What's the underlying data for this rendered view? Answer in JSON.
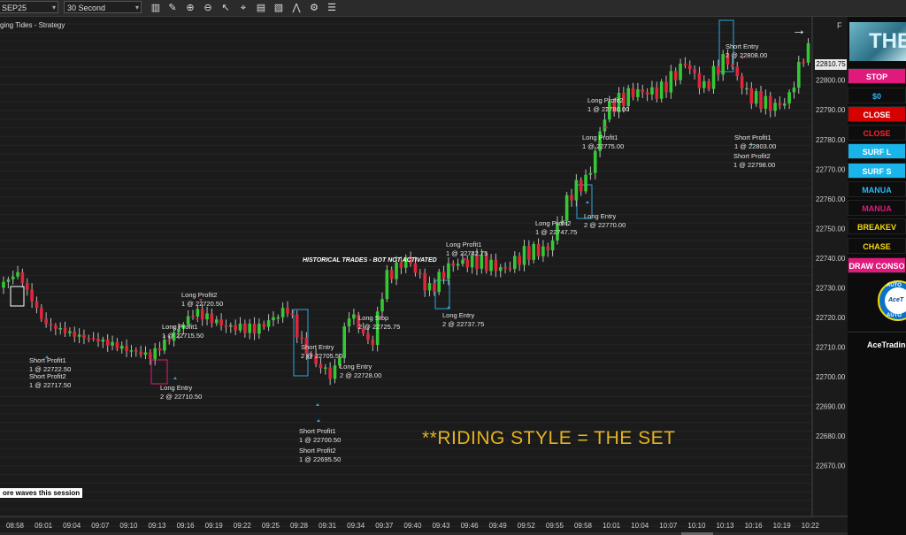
{
  "toolbar": {
    "instrument": "SEP25",
    "interval": "30 Second",
    "icons": [
      "bar-chart-icon",
      "pencil-icon",
      "zoom-in-icon",
      "zoom-out-icon",
      "pointer-icon",
      "crosshair-icon",
      "data-box-icon",
      "template-icon",
      "indicator-icon",
      "strategy-icon",
      "properties-icon"
    ]
  },
  "chart": {
    "title": "ging Tides - Strategy",
    "session_label": "ore waves this session",
    "riding_style": "**RIDING STYLE = THE SET",
    "historical_note": "HISTORICAL TRADES - BOT NOT ACTIVATED",
    "last_price": "22810.75",
    "f_label": "F",
    "price_axis": [
      "22800.00",
      "22790.00",
      "22780.00",
      "22770.00",
      "22760.00",
      "22750.00",
      "22740.00",
      "22730.00",
      "22720.00",
      "22710.00",
      "22700.00",
      "22690.00",
      "22680.00",
      "22670.00"
    ],
    "time_axis": [
      "08:58",
      "09:01",
      "09:04",
      "09:07",
      "09:10",
      "09:13",
      "09:16",
      "09:19",
      "09:22",
      "09:25",
      "09:28",
      "09:31",
      "09:34",
      "09:37",
      "09:40",
      "09:43",
      "09:46",
      "09:49",
      "09:52",
      "09:55",
      "09:58",
      "10:01",
      "10:04",
      "10:07",
      "10:10",
      "10:13",
      "10:16",
      "10:19",
      "10:22"
    ],
    "trade_labels": [
      {
        "l1": "Short Profit1",
        "l2": "1 @ 22722.50"
      },
      {
        "l1": "Short Profit2",
        "l2": "1 @ 22717.50"
      },
      {
        "l1": "Long  Entry",
        "l2": "2 @ 22710.50"
      },
      {
        "l1": "Long Profit1",
        "l2": "1 @ 22715.50"
      },
      {
        "l1": "Long Profit2",
        "l2": "1 @ 22720.50"
      },
      {
        "l1": "Short  Entry",
        "l2": "2 @ 22705.50"
      },
      {
        "l1": "Short Profit1",
        "l2": "1 @ 22700.50"
      },
      {
        "l1": "Short Profit2",
        "l2": "1 @ 22695.50"
      },
      {
        "l1": "Long Stop",
        "l2": "2 @ 22725.75"
      },
      {
        "l1": "Long  Entry",
        "l2": "2 @ 22728.00"
      },
      {
        "l1": "Long Profit1",
        "l2": "1 @ 22742.75"
      },
      {
        "l1": "Long  Entry",
        "l2": "2 @ 22737.75"
      },
      {
        "l1": "Long Profit2",
        "l2": "1 @ 22747.75"
      },
      {
        "l1": "Long  Entry",
        "l2": "2 @ 22770.00"
      },
      {
        "l1": "Long Profit1",
        "l2": "1 @ 22775.00"
      },
      {
        "l1": "Long Profit2",
        "l2": "1 @ 22780.00"
      },
      {
        "l1": "Short  Entry",
        "l2": "2 @ 22808.00"
      },
      {
        "l1": "Short Profit1",
        "l2": "1 @ 22803.00"
      },
      {
        "l1": "Short Profit2",
        "l2": "1 @ 22798.00"
      }
    ]
  },
  "panel": {
    "logo_text": "THE",
    "buttons": [
      {
        "label": "STOP",
        "bg": "#e0197d",
        "fg": "#ffffff"
      },
      {
        "label": "$0",
        "bg": "#0d0d0d",
        "fg": "#29b6f6"
      },
      {
        "label": "CLOSE",
        "bg": "#d50000",
        "fg": "#ffffff"
      },
      {
        "label": "CLOSE",
        "bg": "#0d0d0d",
        "fg": "#ff2222"
      },
      {
        "label": "SURF L",
        "bg": "#18b4ea",
        "fg": "#ffffff"
      },
      {
        "label": "SURF S",
        "bg": "#18b4ea",
        "fg": "#ffffff"
      },
      {
        "label": "MANUA",
        "bg": "#0d0d0d",
        "fg": "#29b6f6"
      },
      {
        "label": "MANUA",
        "bg": "#0d0d0d",
        "fg": "#e0197d"
      },
      {
        "label": "BREAKEV",
        "bg": "#0d0d0d",
        "fg": "#f5d90a"
      },
      {
        "label": "CHASE",
        "bg": "#0d0d0d",
        "fg": "#f5d90a"
      },
      {
        "label": "DRAW CONSO",
        "bg": "#e0197d",
        "fg": "#ffffff"
      }
    ],
    "badge_top": "AUTO",
    "badge_mid": "AceT",
    "badge_bottom": "AUTO",
    "footer": "AceTrading"
  },
  "colors": {
    "up": "#34c934",
    "down": "#e0263a",
    "entry_box": "#29a8e0",
    "profit_arrow": "#e0197d",
    "riding": "#e3b320"
  }
}
